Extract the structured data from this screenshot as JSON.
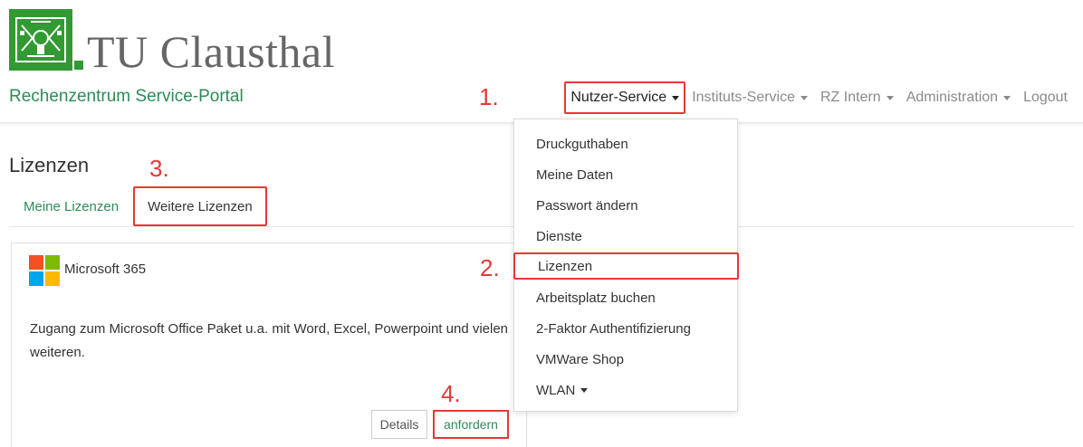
{
  "header": {
    "logo_text": "TU Clausthal",
    "portal_title": "Rechenzentrum Service-Portal",
    "brand_color": "#339933",
    "link_color": "#2e8b57",
    "highlight_color": "#e53935"
  },
  "nav": {
    "items": [
      {
        "label": "Nutzer-Service",
        "has_caret": true
      },
      {
        "label": "Instituts-Service",
        "has_caret": true
      },
      {
        "label": "RZ Intern",
        "has_caret": true
      },
      {
        "label": "Administration",
        "has_caret": true
      },
      {
        "label": "Logout",
        "has_caret": false
      }
    ]
  },
  "dropdown": {
    "items": [
      {
        "label": "Druckguthaben"
      },
      {
        "label": "Meine Daten"
      },
      {
        "label": "Passwort ändern"
      },
      {
        "label": "Dienste"
      },
      {
        "label": "Lizenzen"
      },
      {
        "label": "Arbeitsplatz buchen"
      },
      {
        "label": "2-Faktor Authentifizierung"
      },
      {
        "label": "VMWare Shop"
      },
      {
        "label": "WLAN"
      }
    ]
  },
  "page": {
    "title": "Lizenzen",
    "tabs": [
      {
        "label": "Meine Lizenzen"
      },
      {
        "label": "Weitere Lizenzen"
      }
    ]
  },
  "card": {
    "title": "Microsoft 365",
    "description": "Zugang zum Microsoft Office Paket u.a. mit Word, Excel, Powerpoint und vielen weiteren.",
    "details_label": "Details",
    "request_label": "anfordern",
    "ms_logo_colors": [
      "#f25022",
      "#7fba00",
      "#00a4ef",
      "#ffb900"
    ]
  },
  "steps": {
    "s1": "1.",
    "s2": "2.",
    "s3": "3.",
    "s4": "4."
  }
}
